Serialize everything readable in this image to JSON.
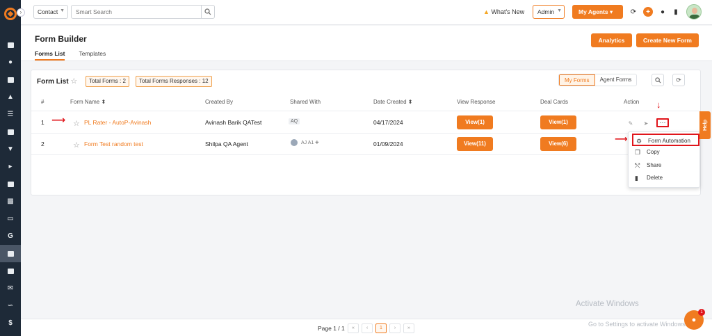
{
  "topbar": {
    "module_select": "Contact",
    "search_placeholder": "Smart Search",
    "whats_new": "What's New",
    "admin_select": "Admin",
    "my_agents": "My Agents"
  },
  "page": {
    "title": "Form Builder",
    "tabs": [
      "Forms List",
      "Templates"
    ],
    "analytics_btn": "Analytics",
    "create_btn": "Create New Form"
  },
  "card": {
    "title": "Form List",
    "total_forms": "Total Forms : 2",
    "total_responses": "Total Forms Responses : 12",
    "toggle_my": "My Forms",
    "toggle_agent": "Agent Forms"
  },
  "table": {
    "headers": [
      "#",
      "Form Name ⬍",
      "Created By",
      "Shared With",
      "Date Created ⬍",
      "View Response",
      "Deal Cards",
      "Action"
    ],
    "rows": [
      {
        "num": "1",
        "name": "PL Rater - AutoP-Avinash",
        "created_by": "Avinash Barik QATest",
        "shared": "AQ",
        "date": "04/17/2024",
        "view_response": "View(1)",
        "deal_cards": "View(1)"
      },
      {
        "num": "2",
        "name": "Form Test random test",
        "created_by": "Shilpa QA Agent",
        "shared": "AJ A1",
        "date": "01/09/2024",
        "view_response": "View(11)",
        "deal_cards": "View(6)"
      }
    ]
  },
  "dropdown": {
    "items": [
      "Form Automation",
      "Copy",
      "Share",
      "Delete"
    ]
  },
  "help": "Help",
  "pager": {
    "info": "Page 1 / 1",
    "current": "1"
  },
  "watermark": {
    "line1": "Activate Windows",
    "line2": "Go to Settings to activate Windows."
  },
  "chat_badge": "1",
  "colors": {
    "accent": "#f07b20",
    "sidebar": "#1e2a38",
    "annotation": "#e0151b"
  }
}
